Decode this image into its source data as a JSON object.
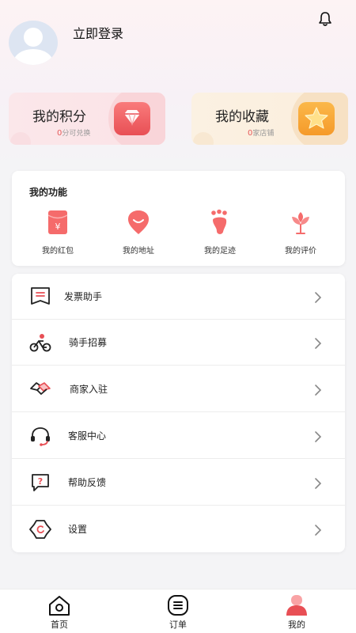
{
  "header": {
    "login_text": "立即登录"
  },
  "cards": {
    "points": {
      "title": "我的积分",
      "count": "0",
      "unit": "分可兑换"
    },
    "favorites": {
      "title": "我的收藏",
      "count": "0",
      "unit": "家店铺"
    }
  },
  "functions": {
    "title": "我的功能",
    "items": [
      {
        "label": "我的红包",
        "icon": "red-packet-icon"
      },
      {
        "label": "我的地址",
        "icon": "address-icon"
      },
      {
        "label": "我的足迹",
        "icon": "footprint-icon"
      },
      {
        "label": "我的评价",
        "icon": "review-icon"
      }
    ]
  },
  "menu": [
    {
      "label": "发票助手",
      "icon": "invoice-icon"
    },
    {
      "label": "骑手招募",
      "icon": "rider-icon"
    },
    {
      "label": "商家入驻",
      "icon": "handshake-icon"
    },
    {
      "label": "客服中心",
      "icon": "headset-icon"
    },
    {
      "label": "帮助反馈",
      "icon": "help-icon"
    },
    {
      "label": "设置",
      "icon": "settings-icon"
    }
  ],
  "tabbar": [
    {
      "label": "首页",
      "icon": "home-icon"
    },
    {
      "label": "订单",
      "icon": "order-icon"
    },
    {
      "label": "我的",
      "icon": "profile-icon"
    }
  ],
  "colors": {
    "accent": "#e84f55",
    "gold": "#f59a2a"
  }
}
